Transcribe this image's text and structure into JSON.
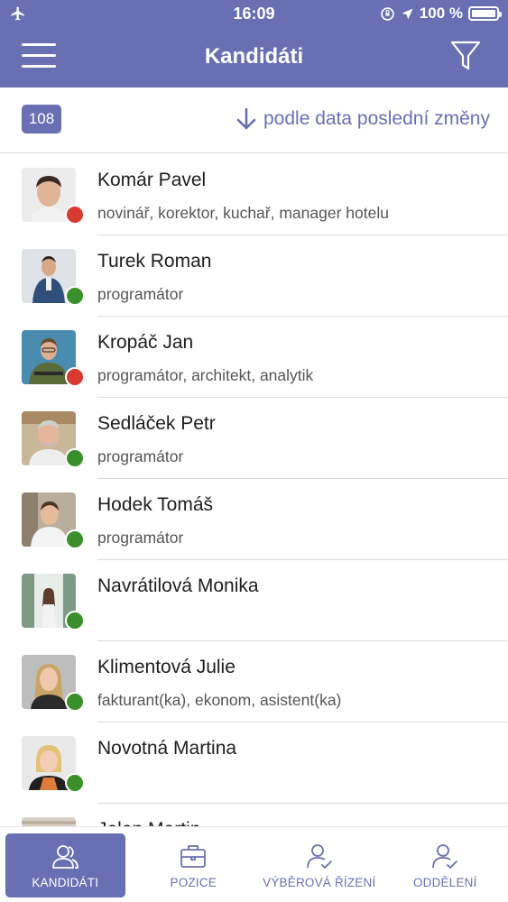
{
  "status_bar": {
    "time": "16:09",
    "battery": "100 %"
  },
  "nav": {
    "title": "Kandidáti",
    "menu_icon": "hamburger-menu-icon",
    "filter_icon": "filter-icon"
  },
  "sort": {
    "count": "108",
    "label": "podle data poslední změny",
    "icon": "arrow-down-icon"
  },
  "colors": {
    "primary": "#6870b3",
    "status_green": "#3a8f2a",
    "status_red": "#d93a30"
  },
  "candidates": [
    {
      "name": "Komár Pavel",
      "roles": "novinář, korektor, kuchař, manager hotelu",
      "status": "red"
    },
    {
      "name": "Turek Roman",
      "roles": "programátor",
      "status": "green"
    },
    {
      "name": "Kropáč Jan",
      "roles": "programátor, architekt, analytik",
      "status": "red"
    },
    {
      "name": "Sedláček Petr",
      "roles": "programátor",
      "status": "green"
    },
    {
      "name": "Hodek Tomáš",
      "roles": "programátor",
      "status": "green"
    },
    {
      "name": "Navrátilová Monika",
      "roles": "",
      "status": "green"
    },
    {
      "name": "Klimentová Julie",
      "roles": "fakturant(ka), ekonom, asistent(ka)",
      "status": "green"
    },
    {
      "name": "Novotná Martina",
      "roles": "",
      "status": "green"
    },
    {
      "name": "Jelen Martin",
      "roles": "",
      "status": "green"
    }
  ],
  "tabs": [
    {
      "label": "KANDIDÁTI",
      "icon": "users-icon",
      "active": true
    },
    {
      "label": "POZICE",
      "icon": "briefcase-icon",
      "active": false
    },
    {
      "label": "VÝBĚROVÁ ŘÍZENÍ",
      "icon": "user-check-icon",
      "active": false
    },
    {
      "label": "ODDĚLENÍ",
      "icon": "user-check-icon",
      "active": false
    }
  ]
}
